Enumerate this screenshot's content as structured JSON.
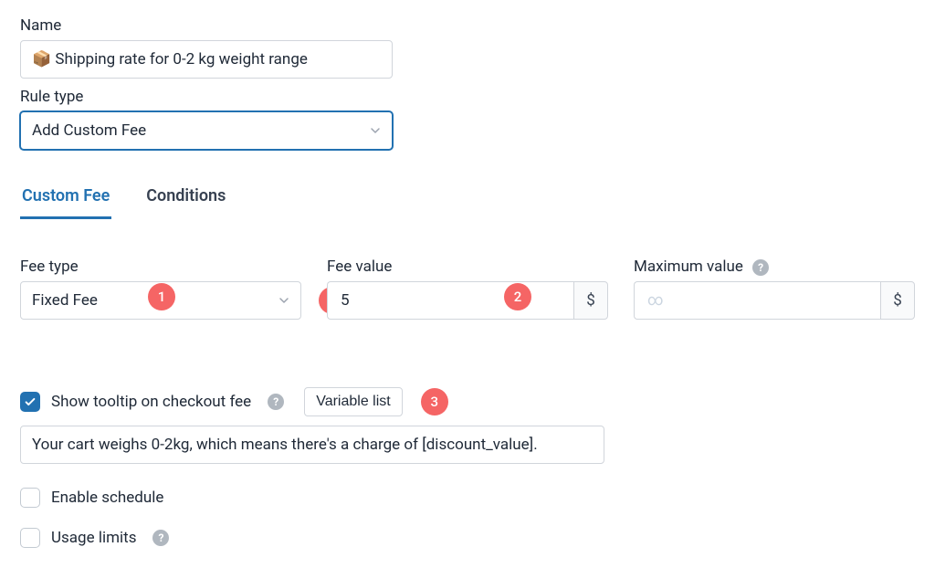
{
  "name": {
    "label": "Name",
    "value": "📦 Shipping rate for 0-2 kg weight range"
  },
  "ruleType": {
    "label": "Rule type",
    "value": "Add Custom Fee"
  },
  "tabs": {
    "customFee": "Custom Fee",
    "conditions": "Conditions"
  },
  "feeType": {
    "label": "Fee type",
    "value": "Fixed Fee"
  },
  "feeValue": {
    "label": "Fee value",
    "value": "5",
    "unit": "$"
  },
  "maxValue": {
    "label": "Maximum value",
    "placeholder": "∞",
    "unit": "$"
  },
  "tooltip": {
    "checkboxLabel": "Show tooltip on checkout fee",
    "variableListBtn": "Variable list",
    "text": "Your cart weighs 0-2kg, which means there's a charge of [discount_value]."
  },
  "schedule": {
    "label": "Enable schedule"
  },
  "usageLimits": {
    "label": "Usage limits"
  },
  "badges": {
    "b1": "1",
    "b2": "2",
    "b3": "3"
  },
  "helpGlyph": "?"
}
